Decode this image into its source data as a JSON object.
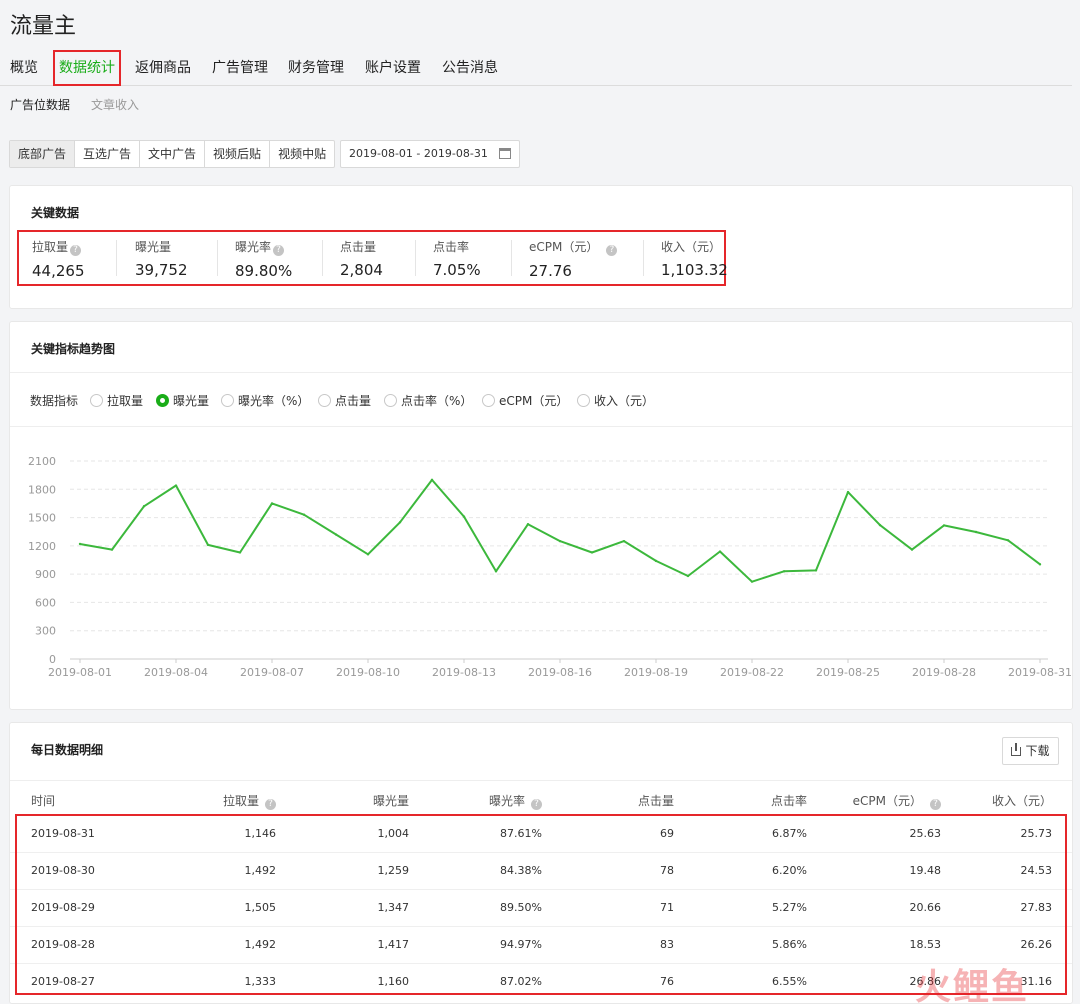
{
  "app": {
    "title": "流量主"
  },
  "nav": {
    "tabs": [
      {
        "label": "概览"
      },
      {
        "label": "数据统计"
      },
      {
        "label": "返佣商品"
      },
      {
        "label": "广告管理"
      },
      {
        "label": "财务管理"
      },
      {
        "label": "账户设置"
      },
      {
        "label": "公告消息"
      }
    ],
    "active_tab": "数据统计"
  },
  "subnav": {
    "items": [
      {
        "label": "广告位数据"
      },
      {
        "label": "文章收入"
      }
    ]
  },
  "ad_types": [
    {
      "label": "底部广告"
    },
    {
      "label": "互选广告"
    },
    {
      "label": "文中广告"
    },
    {
      "label": "视频后贴"
    },
    {
      "label": "视频中贴"
    }
  ],
  "date_range": {
    "value": "2019-08-01 - 2019-08-31"
  },
  "key_data": {
    "title": "关键数据",
    "metrics": [
      {
        "label": "拉取量",
        "value": "44,265",
        "help": true
      },
      {
        "label": "曝光量",
        "value": "39,752",
        "help": false
      },
      {
        "label": "曝光率",
        "value": "89.80%",
        "help": true
      },
      {
        "label": "点击量",
        "value": "2,804",
        "help": false
      },
      {
        "label": "点击率",
        "value": "7.05%",
        "help": false
      },
      {
        "label": "eCPM（元）",
        "value": "27.76",
        "help": true
      },
      {
        "label": "收入（元）",
        "value": "1,103.32",
        "help": false
      }
    ]
  },
  "trend": {
    "title": "关键指标趋势图",
    "selector_label": "数据指标",
    "options": [
      {
        "label": "拉取量",
        "checked": false
      },
      {
        "label": "曝光量",
        "checked": true
      },
      {
        "label": "曝光率（%）",
        "checked": false
      },
      {
        "label": "点击量",
        "checked": false
      },
      {
        "label": "点击率（%）",
        "checked": false
      },
      {
        "label": "eCPM（元）",
        "checked": false
      },
      {
        "label": "收入（元）",
        "checked": false
      }
    ]
  },
  "chart_data": {
    "type": "line",
    "title": "",
    "xlabel": "",
    "ylabel": "",
    "ylim": [
      0,
      2100
    ],
    "yticks": [
      0,
      300,
      600,
      900,
      1200,
      1500,
      1800,
      2100
    ],
    "x_tick_labels": [
      "2019-08-01",
      "2019-08-04",
      "2019-08-07",
      "2019-08-10",
      "2019-08-13",
      "2019-08-16",
      "2019-08-19",
      "2019-08-22",
      "2019-08-25",
      "2019-08-28",
      "2019-08-31"
    ],
    "x": [
      "2019-08-01",
      "2019-08-02",
      "2019-08-03",
      "2019-08-04",
      "2019-08-05",
      "2019-08-06",
      "2019-08-07",
      "2019-08-08",
      "2019-08-09",
      "2019-08-10",
      "2019-08-11",
      "2019-08-12",
      "2019-08-13",
      "2019-08-14",
      "2019-08-15",
      "2019-08-16",
      "2019-08-17",
      "2019-08-18",
      "2019-08-19",
      "2019-08-20",
      "2019-08-21",
      "2019-08-22",
      "2019-08-23",
      "2019-08-24",
      "2019-08-25",
      "2019-08-26",
      "2019-08-27",
      "2019-08-28",
      "2019-08-29",
      "2019-08-30",
      "2019-08-31"
    ],
    "values": [
      1220,
      1160,
      1620,
      1840,
      1210,
      1130,
      1650,
      1530,
      1320,
      1110,
      1450,
      1900,
      1510,
      930,
      1430,
      1250,
      1130,
      1250,
      1040,
      880,
      1140,
      820,
      930,
      940,
      1770,
      1420,
      1160,
      1417,
      1347,
      1259,
      1004
    ],
    "grid": true,
    "line_color": "#3cb83c"
  },
  "daily": {
    "title": "每日数据明细",
    "download_label": "下载",
    "columns": [
      "时间",
      "拉取量",
      "曝光量",
      "曝光率",
      "点击量",
      "点击率",
      "eCPM（元）",
      "收入（元）"
    ],
    "rows": [
      [
        "2019-08-31",
        "1,146",
        "1,004",
        "87.61%",
        "69",
        "6.87%",
        "25.63",
        "25.73"
      ],
      [
        "2019-08-30",
        "1,492",
        "1,259",
        "84.38%",
        "78",
        "6.20%",
        "19.48",
        "24.53"
      ],
      [
        "2019-08-29",
        "1,505",
        "1,347",
        "89.50%",
        "71",
        "5.27%",
        "20.66",
        "27.83"
      ],
      [
        "2019-08-28",
        "1,492",
        "1,417",
        "94.97%",
        "83",
        "5.86%",
        "18.53",
        "26.26"
      ],
      [
        "2019-08-27",
        "1,333",
        "1,160",
        "87.02%",
        "76",
        "6.55%",
        "26.86",
        "31.16"
      ]
    ]
  },
  "watermark": {
    "text": "火鲤鱼"
  }
}
